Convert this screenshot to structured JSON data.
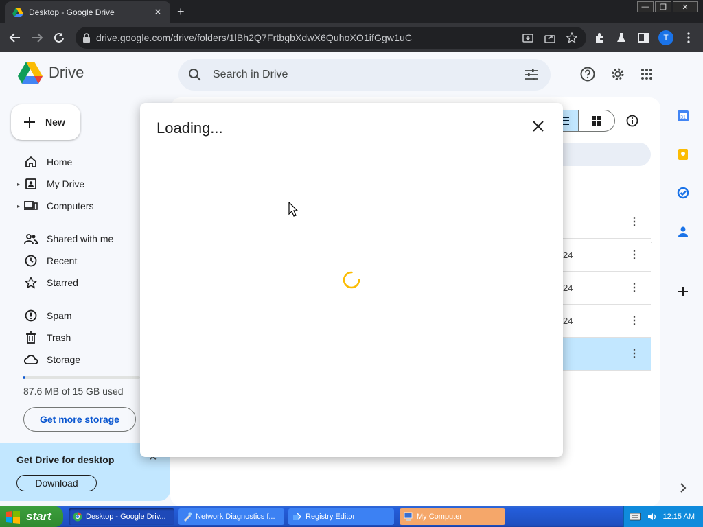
{
  "browser": {
    "tab_title": "Desktop - Google Drive",
    "tab_close": "✕",
    "new_tab": "+",
    "window_controls": [
      "—",
      "❐",
      "✕"
    ],
    "url": "drive.google.com/drive/folders/1lBh2Q7FrtbgbXdwX6QuhoXO1ifGgw1uC",
    "profile_initial": "T"
  },
  "drive": {
    "app_name": "Drive",
    "search_placeholder": "Search in Drive",
    "avatar_initial": "T",
    "new_button": "New",
    "nav": [
      {
        "label": "Home",
        "icon": "home-icon"
      },
      {
        "label": "My Drive",
        "icon": "my-drive-icon"
      },
      {
        "label": "Computers",
        "icon": "computers-icon"
      },
      {
        "label": "Shared with me",
        "icon": "shared-icon"
      },
      {
        "label": "Recent",
        "icon": "clock-icon"
      },
      {
        "label": "Starred",
        "icon": "star-icon"
      },
      {
        "label": "Spam",
        "icon": "spam-icon"
      },
      {
        "label": "Trash",
        "icon": "trash-icon"
      },
      {
        "label": "Storage",
        "icon": "cloud-icon"
      }
    ],
    "storage_used_text": "87.6 MB of 15 GB used",
    "storage_fraction": 0.006,
    "get_more_storage": "Get more storage",
    "promo_title": "Get Drive for desktop",
    "promo_download": "Download",
    "promo_close": "✕",
    "file_rows": [
      {
        "date_fragment": "",
        "more": "⋮"
      },
      {
        "date_fragment": "24",
        "more": "⋮"
      },
      {
        "date_fragment": "24",
        "more": "⋮"
      },
      {
        "date_fragment": "24",
        "more": "⋮"
      },
      {
        "date_fragment": "",
        "more": "⋮"
      }
    ],
    "header_more": "⋮"
  },
  "dialog": {
    "title": "Loading..."
  },
  "taskbar": {
    "start_label": "start",
    "tasks": [
      {
        "label": "Desktop - Google Driv...",
        "active": true
      },
      {
        "label": "Network Diagnostics f...",
        "active": false
      },
      {
        "label": "Registry Editor",
        "active": false
      },
      {
        "label": "My Computer",
        "active": false
      }
    ],
    "clock": "12:15 AM"
  },
  "colors": {
    "accent": "#0b57d0",
    "spinner": "#fbbc04",
    "taskbar": "#245edb"
  }
}
